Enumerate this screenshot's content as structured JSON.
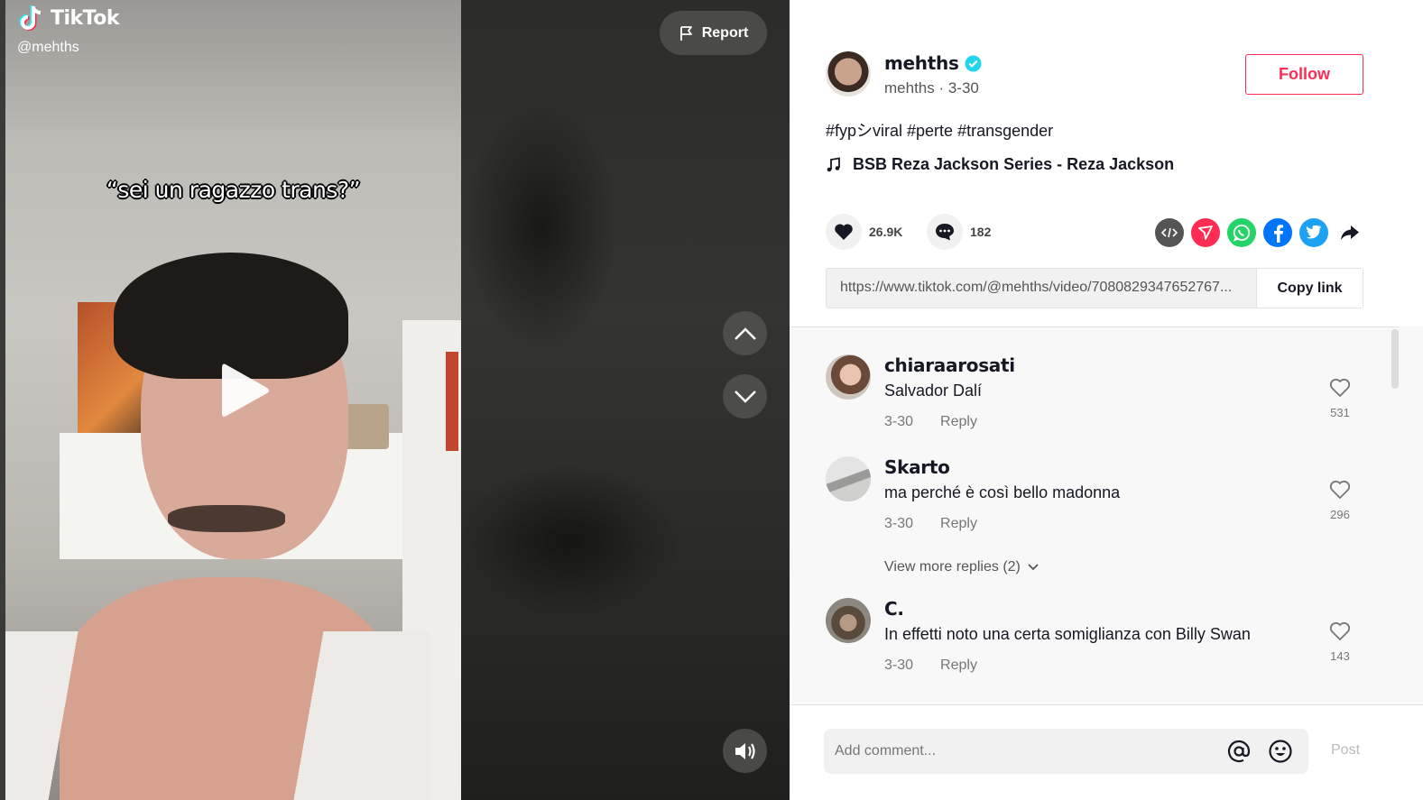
{
  "video": {
    "brand": "TikTok",
    "handle": "@mehths",
    "caption": "“sei un ragazzo trans?”",
    "report_label": "Report"
  },
  "author": {
    "username": "mehths",
    "subline": "mehths · 3-30",
    "follow_label": "Follow",
    "description": "#fypシviral #perte #transgender",
    "music": "BSB Reza Jackson Series - Reza Jackson"
  },
  "stats": {
    "likes": "26.9K",
    "comments": "182"
  },
  "share": {
    "icons": [
      "embed-icon",
      "send-icon",
      "whatsapp-icon",
      "facebook-icon",
      "twitter-icon",
      "share-arrow-icon"
    ]
  },
  "link": {
    "url": "https://www.tiktok.com/@mehths/video/7080829347652767...",
    "copy_label": "Copy link"
  },
  "comments": [
    {
      "name": "chiaraarosati",
      "text": "Salvador Dalí",
      "date": "3-30",
      "reply": "Reply",
      "likes": "531"
    },
    {
      "name": "Skarto",
      "text": "ma perché è così bello madonna",
      "date": "3-30",
      "reply": "Reply",
      "likes": "296",
      "more_replies": "View more replies (2)"
    },
    {
      "name": "C.",
      "text": "In effetti noto una certa somiglianza con Billy Swan",
      "date": "3-30",
      "reply": "Reply",
      "likes": "143"
    }
  ],
  "composer": {
    "placeholder": "Add comment...",
    "post_label": "Post"
  },
  "colors": {
    "accent": "#fe2c55",
    "verified": "#20d5ec"
  }
}
